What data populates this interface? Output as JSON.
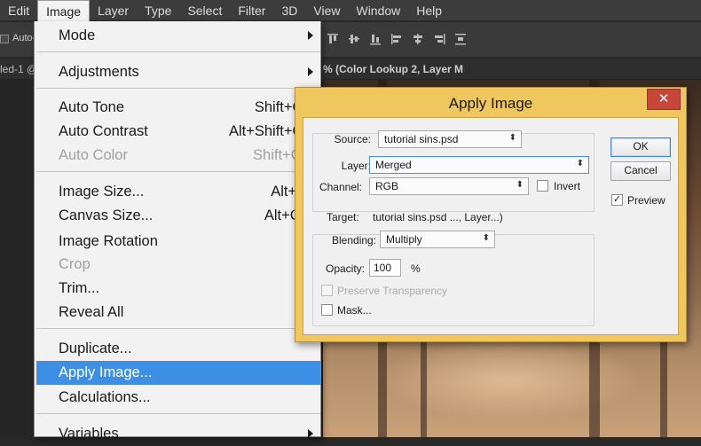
{
  "menubar": {
    "items": [
      "Edit",
      "Image",
      "Layer",
      "Type",
      "Select",
      "Filter",
      "3D",
      "View",
      "Window",
      "Help"
    ],
    "active_index": 1
  },
  "options_bar": {
    "auto_select_label": "Auto-"
  },
  "tabs": {
    "left_doc": "led-1 @",
    "active_doc": "% (Color Lookup 2, Layer M"
  },
  "image_menu": {
    "mode": "Mode",
    "adjustments": "Adjustments",
    "auto_tone": {
      "label": "Auto Tone",
      "shortcut": "Shift+Ctrl+L"
    },
    "auto_contrast": {
      "label": "Auto Contrast",
      "shortcut": "Alt+Shift+Ctrl+L"
    },
    "auto_color": {
      "label": "Auto Color",
      "shortcut": "Shift+Ctrl+B"
    },
    "image_size": {
      "label": "Image Size...",
      "shortcut": "Alt+Ctrl+I"
    },
    "canvas_size": {
      "label": "Canvas Size...",
      "shortcut": "Alt+Ctrl+C"
    },
    "image_rotation": "Image Rotation",
    "crop": "Crop",
    "trim": "Trim...",
    "reveal_all": "Reveal All",
    "duplicate": "Duplicate...",
    "apply_image": "Apply Image...",
    "calculations": "Calculations...",
    "variables": "Variables"
  },
  "dialog": {
    "title": "Apply Image",
    "close": "✕",
    "source_label": "Source:",
    "source_value": "tutorial sins.psd",
    "layer_label": "Layer:",
    "layer_value": "Merged",
    "channel_label": "Channel:",
    "channel_value": "RGB",
    "invert_label": "Invert",
    "target_label": "Target:",
    "target_value": "tutorial sins.psd ..., Layer...)",
    "blending_label": "Blending:",
    "blending_value": "Multiply",
    "opacity_label": "Opacity:",
    "opacity_value": "100",
    "opacity_unit": "%",
    "preserve_label": "Preserve Transparency",
    "mask_label": "Mask...",
    "ok_label": "OK",
    "cancel_label": "Cancel",
    "preview_label": "Preview",
    "preview_checked": "✓",
    "caret": "⬍"
  }
}
